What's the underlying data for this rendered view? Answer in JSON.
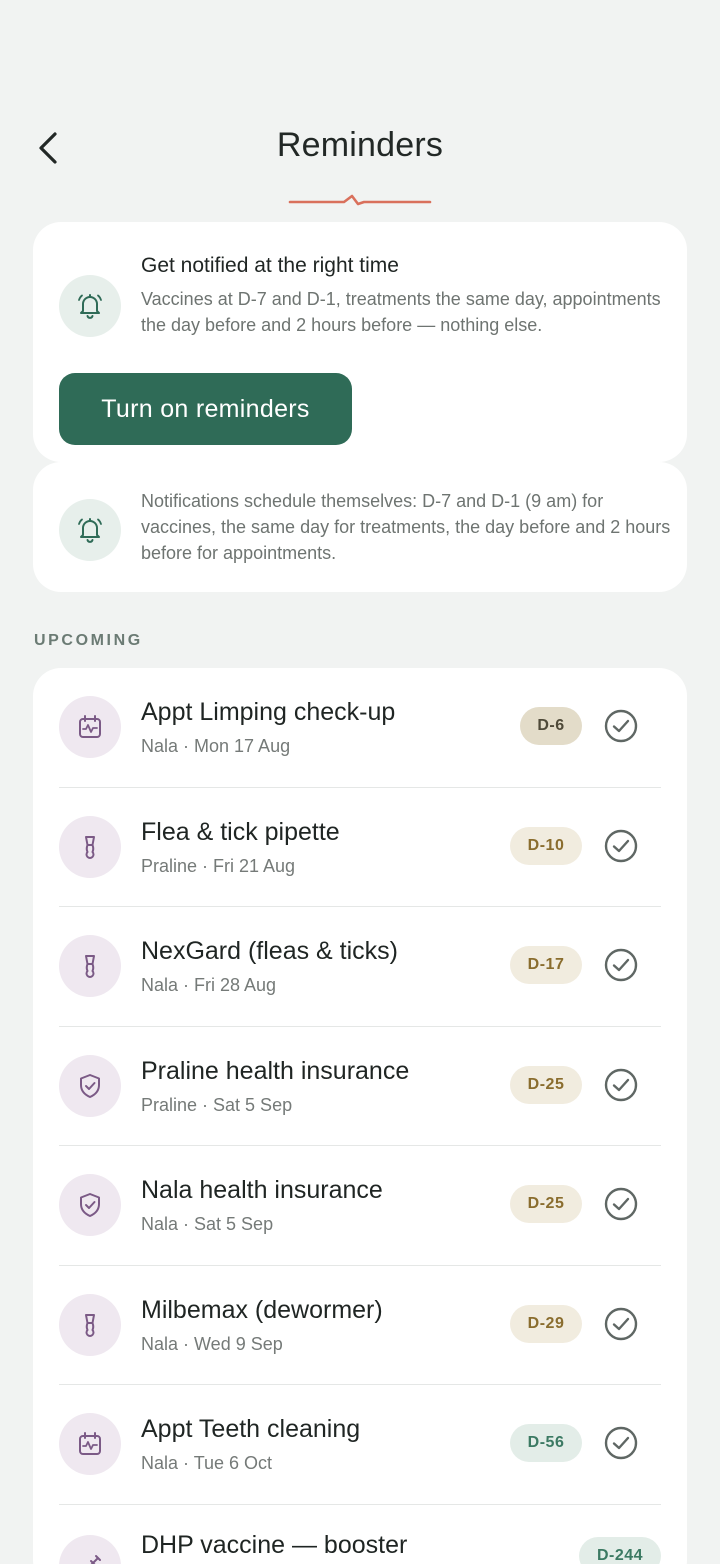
{
  "header": {
    "title": "Reminders"
  },
  "promo": {
    "title": "Get notified at the right time",
    "text": "Vaccines at D-7 and D-1, treatments the same day, appointments the day before and 2 hours before — nothing else.",
    "button_label": "Turn on reminders"
  },
  "info": {
    "text": "Notifications schedule themselves: D-7 and D-1 (9 am) for vaccines, the same day for treatments, the day before and 2 hours before for appointments."
  },
  "section": {
    "label": "UPCOMING"
  },
  "reminders": [
    {
      "title": "Appt Limping check-up",
      "subtitle": "Nala · Mon 17 Aug",
      "badge": "D-6",
      "icon": "calendar-icon"
    },
    {
      "title": "Flea & tick pipette",
      "subtitle": "Praline · Fri 21 Aug",
      "badge": "D-10",
      "icon": "pipette-icon"
    },
    {
      "title": "NexGard (fleas & ticks)",
      "subtitle": "Nala · Fri 28 Aug",
      "badge": "D-17",
      "icon": "pipette-icon"
    },
    {
      "title": "Praline health insurance",
      "subtitle": "Praline · Sat 5 Sep",
      "badge": "D-25",
      "icon": "shield-icon"
    },
    {
      "title": "Nala health insurance",
      "subtitle": "Nala · Sat 5 Sep",
      "badge": "D-25",
      "icon": "shield-icon"
    },
    {
      "title": "Milbemax (dewormer)",
      "subtitle": "Nala · Wed 9 Sep",
      "badge": "D-29",
      "icon": "pipette-icon"
    },
    {
      "title": "Appt Teeth cleaning",
      "subtitle": "Nala · Tue 6 Oct",
      "badge": "D-56",
      "icon": "calendar-icon"
    },
    {
      "title": "DHP vaccine — booster",
      "subtitle": "",
      "badge": "D-244",
      "icon": "syringe-icon"
    }
  ],
  "colors": {
    "background": "#f1f3f2",
    "primary": "#2f6b57",
    "accent": "#d9705c",
    "icon_purple": "#7b5a86"
  }
}
